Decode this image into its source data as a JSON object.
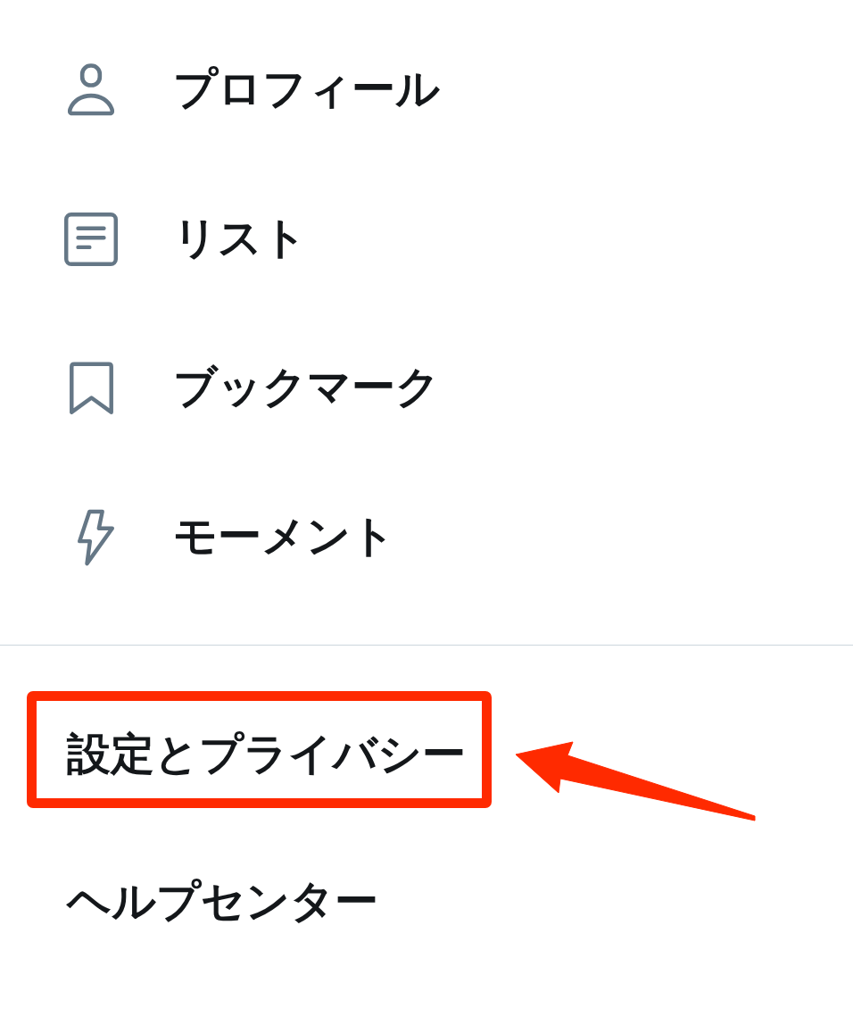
{
  "menu": {
    "items": [
      {
        "label": "プロフィール"
      },
      {
        "label": "リスト"
      },
      {
        "label": "ブックマーク"
      },
      {
        "label": "モーメント"
      }
    ]
  },
  "secondary": {
    "items": [
      {
        "label": "設定とプライバシー",
        "highlighted": true
      },
      {
        "label": "ヘルプセンター",
        "highlighted": false
      }
    ]
  }
}
